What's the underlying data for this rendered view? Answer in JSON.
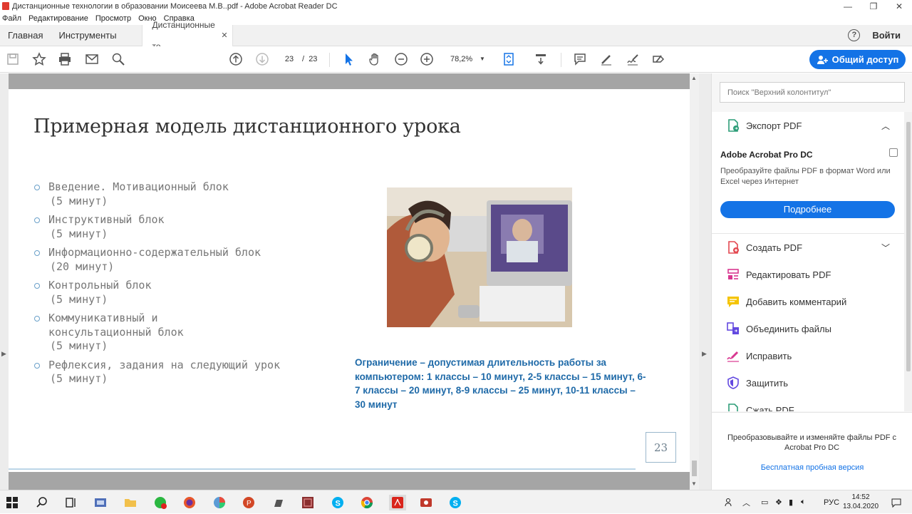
{
  "window": {
    "title": "Дистанционные технологии в образовании Моисеева М.В..pdf - Adobe Acrobat Reader DC",
    "minimize": "—",
    "maximize": "❐",
    "close": "✕"
  },
  "menu": [
    "Файл",
    "Редактирование",
    "Просмотр",
    "Окно",
    "Справка"
  ],
  "tabs": {
    "home": "Главная",
    "tools": "Инструменты",
    "document": "Дистанционные те...",
    "help": "?",
    "signin": "Войти"
  },
  "toolbar": {
    "current_page": "23",
    "page_separator": "/",
    "total_pages": "23",
    "zoom": "78,2%",
    "share_label": "Общий доступ"
  },
  "slide": {
    "title": "Примерная модель дистанционного урока",
    "bullets": [
      {
        "text": "Введение. Мотивационный блок",
        "time": "(5 минут)"
      },
      {
        "text": "Инструктивный блок",
        "time": "(5 минут)"
      },
      {
        "text": "Информационно-содержательный блок",
        "time": "(20 минут)"
      },
      {
        "text": "Контрольный блок",
        "time": "(5 минут)"
      },
      {
        "text": "Коммуникативный и консультационный блок",
        "time": "(5 минут)"
      },
      {
        "text": "Рефлексия, задания на следующий урок",
        "time": "(5 минут)"
      }
    ],
    "note": "Ограничение – допустимая длительность работы за компьютером: 1 классы – 10 минут, 2-5 классы – 15 минут, 6-7 классы – 20 минут, 8-9 классы – 25 минут, 10-11 классы – 30 минут",
    "page_number": "23"
  },
  "right_panel": {
    "search_placeholder": "Поиск \"Верхний колонтитул\"",
    "export_pdf": "Экспорт PDF",
    "promo_title": "Adobe Acrobat Pro DC",
    "promo_desc": "Преобразуйте файлы PDF в формат Word или Excel через Интернет",
    "promo_button": "Подробнее",
    "tools": [
      {
        "label": "Создать PDF",
        "icon": "create-pdf-icon",
        "color": "#e34850"
      },
      {
        "label": "Редактировать PDF",
        "icon": "edit-pdf-icon",
        "color": "#d83790"
      },
      {
        "label": "Добавить комментарий",
        "icon": "comment-icon",
        "color": "#f5c400"
      },
      {
        "label": "Объединить файлы",
        "icon": "combine-files-icon",
        "color": "#6349e0"
      },
      {
        "label": "Исправить",
        "icon": "fill-sign-icon",
        "color": "#d83790"
      },
      {
        "label": "Защитить",
        "icon": "protect-icon",
        "color": "#6349e0"
      },
      {
        "label": "Сжать PDF",
        "icon": "compress-pdf-icon",
        "color": "#2d9d78"
      }
    ],
    "bottom_text": "Преобразовывайте и изменяйте файлы PDF с Acrobat Pro DC",
    "bottom_link": "Бесплатная пробная версия"
  },
  "taskbar": {
    "language": "РУС",
    "time": "14:52",
    "date": "13.04.2020"
  },
  "colors": {
    "accent": "#1473e6",
    "note_text": "#1f6aa8"
  }
}
